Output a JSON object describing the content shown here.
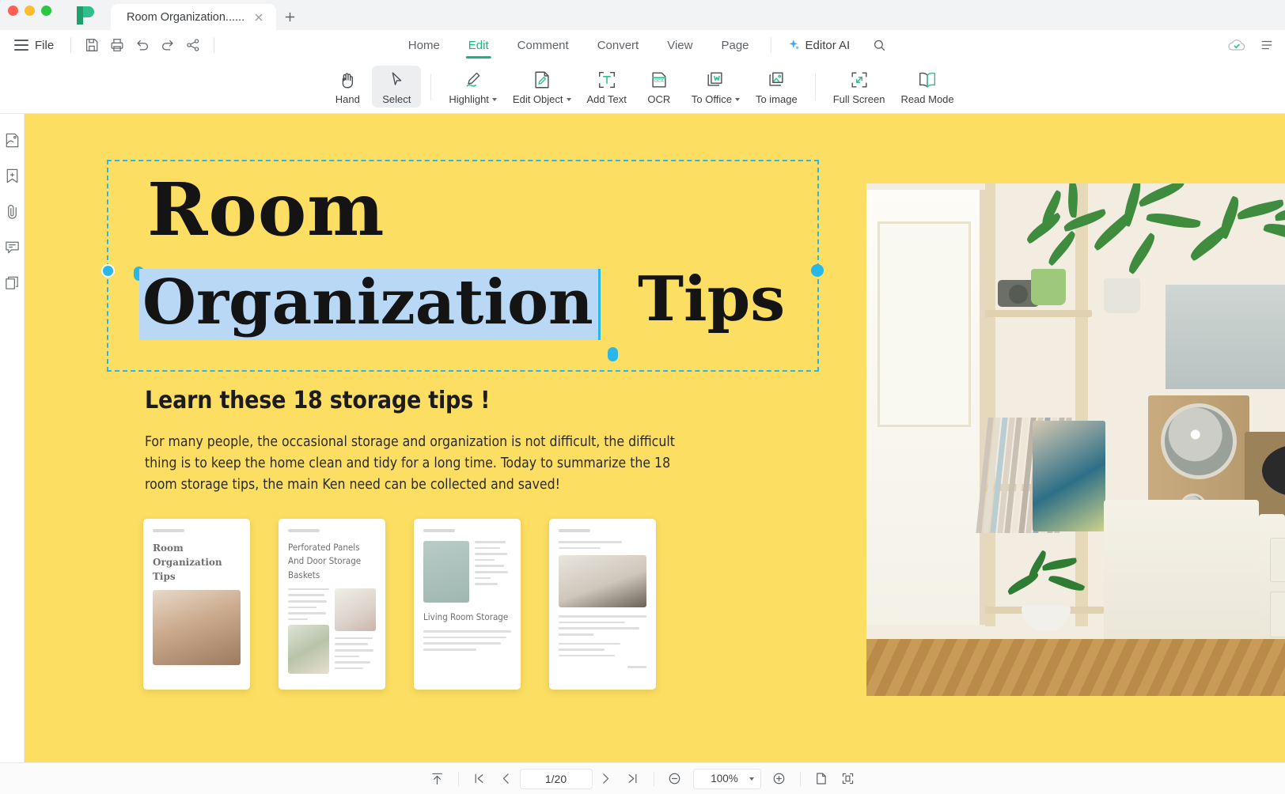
{
  "window": {
    "traffic_lights": [
      "close",
      "minimize",
      "maximize"
    ],
    "app_logo": "pdf-app-logo"
  },
  "tab": {
    "title": "Room Organization......",
    "close_icon": "close-icon",
    "new_tab_icon": "plus-icon"
  },
  "menubar": {
    "hamburger_icon": "hamburger-icon",
    "file_label": "File",
    "quick_tools": [
      {
        "name": "save-button",
        "icon": "save-icon"
      },
      {
        "name": "print-button",
        "icon": "print-icon"
      },
      {
        "name": "undo-button",
        "icon": "undo-icon"
      },
      {
        "name": "redo-button",
        "icon": "redo-icon"
      },
      {
        "name": "share-button",
        "icon": "share-icon"
      }
    ],
    "tabs": [
      {
        "label": "Home",
        "active": false
      },
      {
        "label": "Edit",
        "active": true
      },
      {
        "label": "Comment",
        "active": false
      },
      {
        "label": "Convert",
        "active": false
      },
      {
        "label": "View",
        "active": false
      },
      {
        "label": "Page",
        "active": false
      }
    ],
    "ai_label": "Editor AI",
    "ai_icon": "sparkle-icon",
    "search_icon": "search-icon",
    "cloud_icon": "cloud-sync-icon",
    "more_icon": "more-menu-icon",
    "accent_color": "#19b77b"
  },
  "ribbon": {
    "items": [
      {
        "label": "Hand",
        "icon": "hand-icon",
        "dropdown": false,
        "selected": false
      },
      {
        "label": "Select",
        "icon": "cursor-icon",
        "dropdown": false,
        "selected": true
      },
      {
        "label": "Highlight",
        "icon": "highlighter-icon",
        "dropdown": true,
        "selected": false
      },
      {
        "label": "Edit Object",
        "icon": "edit-object-icon",
        "dropdown": true,
        "selected": false
      },
      {
        "label": "Add Text",
        "icon": "add-text-icon",
        "dropdown": false,
        "selected": false
      },
      {
        "label": "OCR",
        "icon": "ocr-icon",
        "dropdown": false,
        "selected": false
      },
      {
        "label": "To Office",
        "icon": "to-office-icon",
        "dropdown": true,
        "selected": false
      },
      {
        "label": "To image",
        "icon": "to-image-icon",
        "dropdown": false,
        "selected": false
      },
      {
        "label": "Full Screen",
        "icon": "fullscreen-icon",
        "dropdown": false,
        "selected": false
      },
      {
        "label": "Read Mode",
        "icon": "read-mode-icon",
        "dropdown": false,
        "selected": false
      }
    ]
  },
  "sidebar": {
    "items": [
      {
        "name": "thumbnails-panel",
        "icon": "page-thumbnail-icon"
      },
      {
        "name": "bookmarks-panel",
        "icon": "bookmark-add-icon"
      },
      {
        "name": "attachments-panel",
        "icon": "paperclip-icon"
      },
      {
        "name": "comments-panel",
        "icon": "comment-icon"
      },
      {
        "name": "layers-panel",
        "icon": "layers-icon"
      }
    ]
  },
  "document": {
    "background_color": "#FCDE62",
    "selection_color": "#29b6e8",
    "highlight_color": "#b8d8f5",
    "title_line1": "Room",
    "title_selected_word": "Organization",
    "title_word3": "Tips",
    "subheading": "Learn these 18   storage tips !",
    "paragraph": "For many people, the occasional storage and organization is not difficult, the difficult thing is to keep the home clean and tidy for a long time. Today to summarize the 18 room storage tips, the main Ken need can be collected and saved!",
    "cards": [
      {
        "title": "Room Organization Tips",
        "serif": true
      },
      {
        "title": "Perforated Panels And Door Storage Baskets",
        "serif": false
      },
      {
        "title": "Living Room Storage",
        "serif": false
      },
      {
        "title": "",
        "serif": false
      }
    ],
    "photo_alt": "room-interior-photo"
  },
  "statusbar": {
    "scroll_top_icon": "scroll-to-top-icon",
    "first_page_icon": "first-page-icon",
    "prev_page_icon": "previous-page-icon",
    "page_value": "1/20",
    "next_page_icon": "next-page-icon",
    "last_page_icon": "last-page-icon",
    "zoom_out_icon": "zoom-out-icon",
    "zoom_value": "100%",
    "zoom_caret_icon": "chevron-down-icon",
    "zoom_in_icon": "zoom-in-icon",
    "single-page_icon": "single-page-view-icon",
    "fit_page_icon": "fit-page-icon"
  }
}
